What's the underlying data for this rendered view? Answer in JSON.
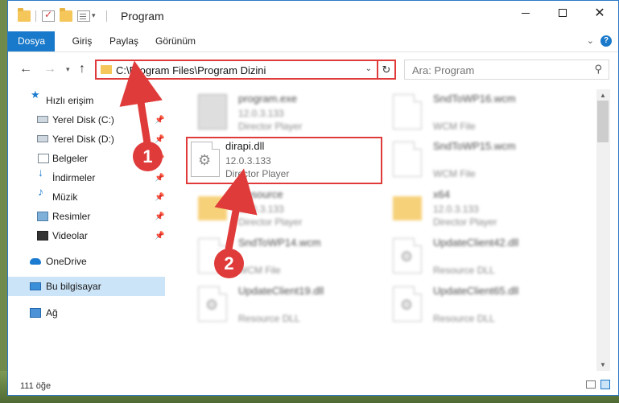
{
  "window": {
    "title": "Program"
  },
  "ribbon": {
    "tabs": [
      "Dosya",
      "Giriş",
      "Paylaş",
      "Görünüm"
    ]
  },
  "navigation": {
    "address": "C:\\Program Files\\Program Dizini",
    "search_placeholder": "Ara: Program"
  },
  "sidebar": {
    "items": [
      {
        "label": "Hızlı erişim",
        "icon": "star-icon"
      },
      {
        "label": "Yerel Disk (C:)",
        "icon": "drive-icon",
        "pinned": true
      },
      {
        "label": "Yerel Disk (D:)",
        "icon": "drive-icon",
        "pinned": true
      },
      {
        "label": "Belgeler",
        "icon": "documents-icon",
        "pinned": true
      },
      {
        "label": "İndirmeler",
        "icon": "download-icon",
        "pinned": true
      },
      {
        "label": "Müzik",
        "icon": "music-icon",
        "pinned": true
      },
      {
        "label": "Resimler",
        "icon": "pictures-icon",
        "pinned": true
      },
      {
        "label": "Videolar",
        "icon": "videos-icon",
        "pinned": true
      },
      {
        "label": "OneDrive",
        "icon": "onedrive-icon"
      },
      {
        "label": "Bu bilgisayar",
        "icon": "computer-icon",
        "selected": true
      },
      {
        "label": "Ağ",
        "icon": "network-icon"
      }
    ]
  },
  "files": [
    {
      "name": "program.exe",
      "version": "12.0.3.133",
      "type": "Director Player"
    },
    {
      "name": "SndToWP16.wcm",
      "version": "",
      "type": "WCM File"
    },
    {
      "name": "dirapi.dll",
      "version": "12.0.3.133",
      "type": "Director Player"
    },
    {
      "name": "SndToWP15.wcm",
      "version": "",
      "type": "WCM File"
    },
    {
      "name": "Resource",
      "version": "12.0.3.133",
      "type": "Director Player"
    },
    {
      "name": "x64",
      "version": "12.0.3.133",
      "type": "Director Player"
    },
    {
      "name": "SndToWP14.wcm",
      "version": "",
      "type": "WCM File"
    },
    {
      "name": "UpdateClient42.dll",
      "version": "",
      "type": "Resource DLL"
    },
    {
      "name": "UpdateClient19.dll",
      "version": "",
      "type": "Resource DLL"
    },
    {
      "name": "UpdateClient65.dll",
      "version": "",
      "type": "Resource DLL"
    }
  ],
  "status": {
    "count": "111 öğe"
  },
  "annotations": {
    "callout_1": "1",
    "callout_2": "2"
  },
  "colors": {
    "accent": "#1979ca",
    "highlight": "#e03b3b",
    "selection": "#cce4f7"
  }
}
